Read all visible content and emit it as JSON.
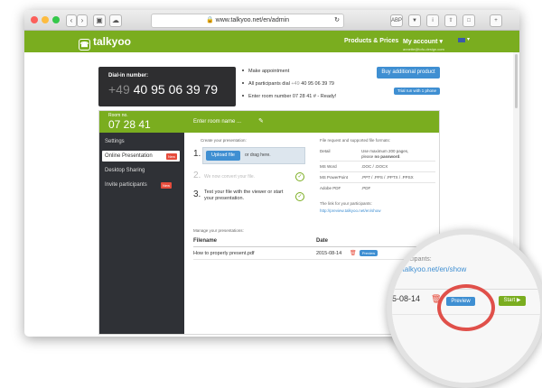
{
  "browser": {
    "url": "www.talkyoo.net/en/admin",
    "traffic_colors": [
      "#fc605b",
      "#fdbc40",
      "#34c84a"
    ]
  },
  "header": {
    "logo": "talkyoo",
    "products_label": "Products & Prices",
    "account_label": "My account",
    "account_email": "annette@tofu-design.com",
    "brand_color": "#7aad1f"
  },
  "dial": {
    "label": "Dial-in number:",
    "country_code": "+49",
    "number": "40 95 06 39 79"
  },
  "steps": [
    {
      "text": "Make appointment"
    },
    {
      "prefix": "All participants dial ",
      "cc": "+49",
      "rest": " 40 95 06 39 79"
    },
    {
      "text": "Enter room number 07 28 41 # - Ready!"
    }
  ],
  "buttons": {
    "buy_label": "Buy additional product",
    "trial_label": "Trial run with 1 phone"
  },
  "room": {
    "label": "Room no.",
    "number": "07 28 41",
    "name_placeholder": "Enter room name ..."
  },
  "sidebar": {
    "items": [
      {
        "label": "Settings"
      },
      {
        "label": "Online Presentation",
        "badge": "New"
      },
      {
        "label": "Desktop Sharing"
      },
      {
        "label": "Invite participants",
        "badge": "New"
      }
    ]
  },
  "create": {
    "heading": "Create your presentation:",
    "step1_num": "1.",
    "upload_label": "Upload file",
    "drag_text": "or drag here.",
    "step2_num": "2.",
    "step2_text": "We now convert your file.",
    "step3_num": "3.",
    "step3_line1": "Test your file with the viewer or start",
    "step3_line2": "your presentation."
  },
  "formats": {
    "heading": "File request and supported file formats:",
    "rows": [
      {
        "key": "Detail",
        "value": "Use maximum 200 pages,",
        "value2_prefix": "please ",
        "value2_bold": "no password",
        "value2_suffix": "."
      },
      {
        "key": "MS Word",
        "value": ".DOC / .DOCX"
      },
      {
        "key": "MS PowerPoint",
        "value": ".PPT / .PPS / .PPTX / .PPSX"
      },
      {
        "key": "Adobe PDF",
        "value": ".PDF"
      }
    ],
    "link_heading": "The link for your participants:",
    "link": "http://preview.talkyoo.net/en/show"
  },
  "manage": {
    "heading": "Manage your presentations:",
    "columns": [
      "Filename",
      "Date"
    ],
    "rows": [
      {
        "filename": "How to properly present.pdf",
        "date": "2015-08-14",
        "preview": "Preview",
        "start": "Start"
      }
    ]
  },
  "zoom": {
    "heading": "participants:",
    "link": "w.talkyoo.net/en/show",
    "date": "5-08-14",
    "preview": "Preview",
    "start": "Start",
    "highlight_color": "#e0504a"
  }
}
